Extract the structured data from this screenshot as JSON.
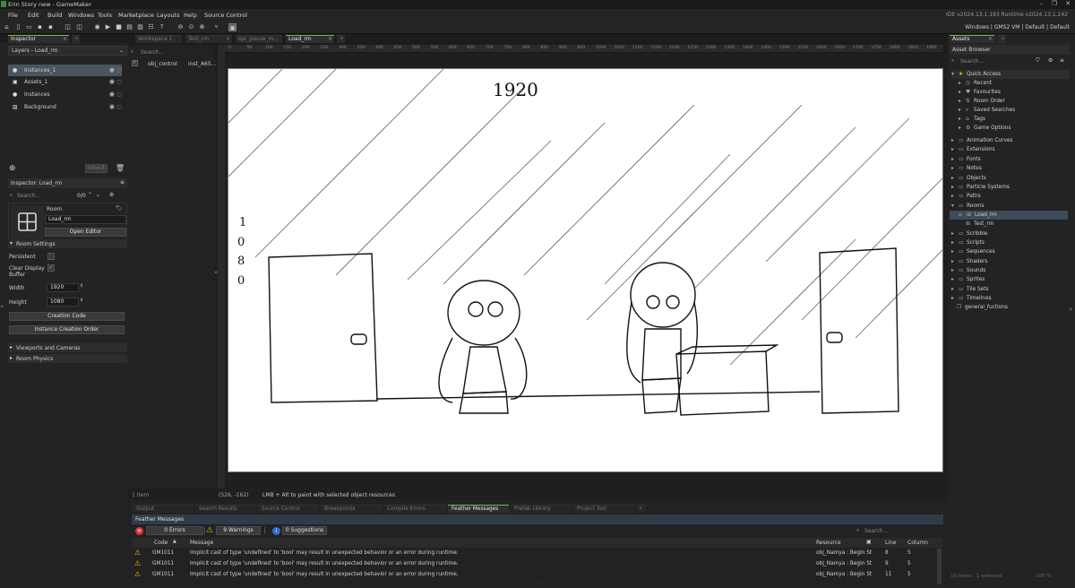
{
  "window": {
    "title": "Erin Story new - GameMaker",
    "controls": [
      "–",
      "❐",
      "✕"
    ]
  },
  "menu": {
    "items": [
      "File",
      "Edit",
      "Build",
      "Windows",
      "Tools",
      "Marketplace",
      "Layouts",
      "Help",
      "Source Control"
    ],
    "version": "IDE v2024.13.1.193  Runtime v2024.13.1.242"
  },
  "toolbar": {
    "target": "Windows | GMS2 VM | Default | Default"
  },
  "inspector": {
    "tab": "Inspector",
    "layers_title": "Layers - Load_rm",
    "layers": [
      "Instances_1",
      "Assets_1",
      "Instances",
      "Background"
    ],
    "inherit_label": "Inherit",
    "sub_title": "Inspector: Load_rm",
    "search_placeholder": "Search...",
    "count": "0/0",
    "room_label": "Room",
    "room_name": "Load_rm",
    "open_editor": "Open Editor",
    "room_settings": "Room Settings",
    "persistent": "Persistent",
    "clear_display": "Clear Display Buffer",
    "width_label": "Width",
    "width_value": "1920",
    "height_label": "Height",
    "height_value": "1080",
    "creation_code": "Creation Code",
    "instance_order": "Instance Creation Order",
    "viewports": "Viewports and Cameras",
    "physics": "Room Physics"
  },
  "workspace": {
    "tabs": [
      "Workspace 1",
      "Test_rm",
      "spr_pause_m...",
      "Load_rm"
    ],
    "search_placeholder": "Search...",
    "instance_name": "obj_control",
    "instance_id": "inst_A65...",
    "ruler": [
      "0",
      "50",
      "100",
      "150",
      "200",
      "250",
      "300",
      "350",
      "400",
      "450",
      "500",
      "550",
      "600",
      "650",
      "700",
      "750",
      "800",
      "850",
      "900",
      "950",
      "1000",
      "1050",
      "1100",
      "1150",
      "1200",
      "1250",
      "1300",
      "1350",
      "1400",
      "1450",
      "1500",
      "1550",
      "1600",
      "1650",
      "1700",
      "1750",
      "1800",
      "1850",
      "1900",
      "1950"
    ],
    "status_items": "1 item",
    "status_coords": "(526, -162)",
    "status_hint": "LMB + Alt to paint with selected object resources",
    "canvas_text_top": "1920",
    "canvas_text_side": [
      "1",
      "0",
      "8",
      "0"
    ]
  },
  "assets": {
    "tab": "Assets",
    "browser": "Asset Browser",
    "search_placeholder": "Search...",
    "quick_access": "Quick Access",
    "quick_items": [
      "Recent",
      "Favourites",
      "Room Order",
      "Saved Searches",
      "Tags",
      "Game Options"
    ],
    "folders": [
      "Animation Curves",
      "Extensions",
      "Fonts",
      "Notes",
      "Objects",
      "Particle Systems",
      "Paths",
      "Rooms"
    ],
    "rooms": [
      "Load_rm",
      "Test_rm"
    ],
    "folders2": [
      "Scribble",
      "Scripts",
      "Sequences",
      "Shaders",
      "Sounds",
      "Sprites",
      "Tile Sets",
      "Timelines"
    ],
    "script": "general_fuctions",
    "footer_items": "10 items",
    "footer_selected": "1 selected",
    "zoom": "100 %"
  },
  "output": {
    "tabs": [
      "Output",
      "Search Results",
      "Source Control",
      "Breakpoints",
      "Compile Errors",
      "Feather Messages",
      "Prefab Library",
      "Project Tool"
    ],
    "title": "Feather Messages",
    "errors": "0 Errors",
    "warnings": "9 Warnings",
    "suggestions": "0 Suggestions",
    "search_placeholder": "Search...",
    "headers": {
      "code": "Code",
      "message": "Message",
      "resource": "Resource",
      "line": "Line",
      "column": "Column"
    },
    "rows": [
      {
        "code": "GM1011",
        "message": "Implicit cast of type 'undefined' to 'bool' may result in unexpected behavior or an error during runtime.",
        "resource": "obj_Namya : Begin St",
        "line": "8",
        "column": "5"
      },
      {
        "code": "GM1011",
        "message": "Implicit cast of type 'undefined' to 'bool' may result in unexpected behavior or an error during runtime.",
        "resource": "obj_Namya : Begin St",
        "line": "9",
        "column": "5"
      },
      {
        "code": "GM1011",
        "message": "Implicit cast of type 'undefined' to 'bool' may result in unexpected behavior or an error during runtime.",
        "resource": "obj_Namya : Begin St",
        "line": "11",
        "column": "5"
      }
    ]
  }
}
